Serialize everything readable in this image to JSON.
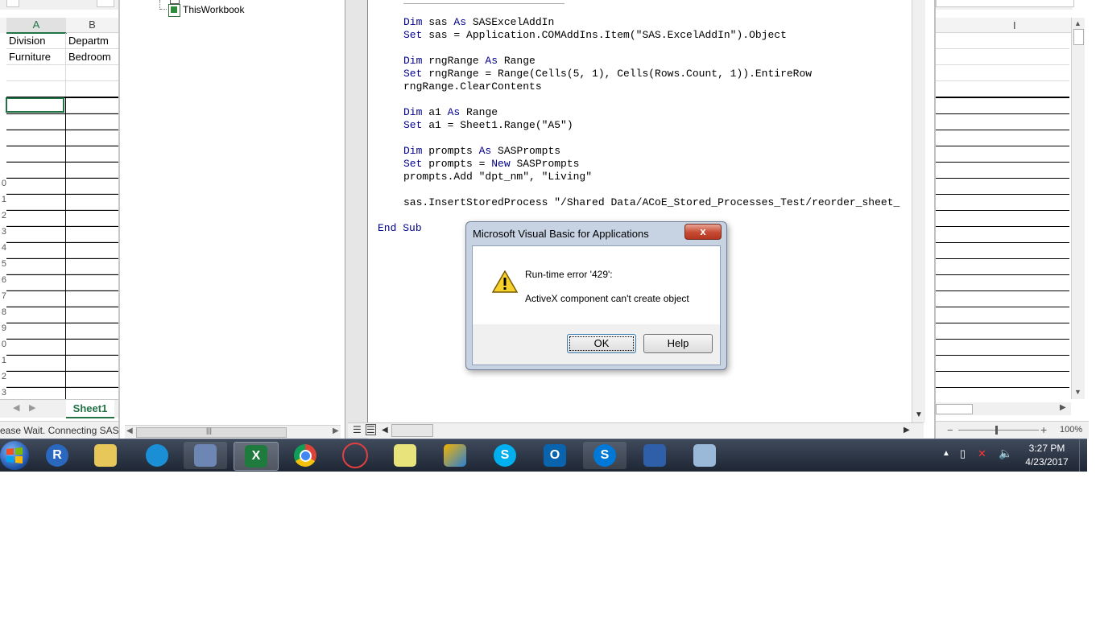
{
  "excel": {
    "col_a": "A",
    "col_b": "B",
    "cells": {
      "a1": "Division",
      "b1": "Departm",
      "a2": "Furniture",
      "b2": "Bedroom"
    },
    "row_numbers": [
      "0",
      "1",
      "2",
      "3",
      "4",
      "5",
      "6",
      "7",
      "8",
      "9",
      "0",
      "1",
      "2",
      "3"
    ],
    "sheet_tab": "Sheet1",
    "status": "ease Wait. Connecting SAS",
    "col_right": "I",
    "zoom": "100%"
  },
  "vba": {
    "tree_item": "ThisWorkbook",
    "code": {
      "l1a": "Dim",
      "l1b": " sas ",
      "l1c": "As",
      "l1d": " SASExcelAddIn",
      "l2a": "Set",
      "l2b": " sas = Application.COMAddIns.Item(\"SAS.ExcelAddIn\").Object",
      "l3a": "Dim",
      "l3b": " rngRange ",
      "l3c": "As",
      "l3d": " Range",
      "l4a": "Set",
      "l4b": " rngRange = Range(Cells(5, 1), Cells(Rows.Count, 1)).EntireRow",
      "l5": "rngRange.ClearContents",
      "l6a": "Dim",
      "l6b": " a1 ",
      "l6c": "As",
      "l6d": " Range",
      "l7a": "Set",
      "l7b": " a1 = Sheet1.Range(\"A5\")",
      "l8a": "Dim",
      "l8b": " prompts ",
      "l8c": "As",
      "l8d": " SASPrompts",
      "l9a": "Set",
      "l9b": " prompts = ",
      "l9c": "New",
      "l9d": " SASPrompts",
      "l10": "prompts.Add \"dpt_nm\", \"Living\"",
      "l11": "sas.InsertStoredProcess \"/Shared Data/ACoE_Stored_Processes_Test/reorder_sheet_",
      "l12a": "End",
      "l12b": " ",
      "l12c": "Sub"
    }
  },
  "dialog": {
    "title": "Microsoft Visual Basic for Applications",
    "close": "x",
    "error_title": "Run-time error '429':",
    "error_message": "ActiveX component can't create object",
    "ok": "OK",
    "help": "Help"
  },
  "taskbar": {
    "time": "3:27 PM",
    "date": "4/23/2017",
    "excel_letter": "X",
    "outlook_letter": "O",
    "skype_letter": "S",
    "r_letter": "R"
  }
}
